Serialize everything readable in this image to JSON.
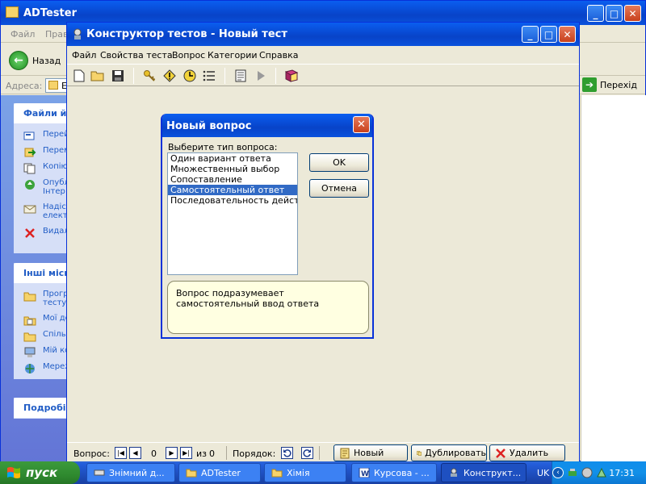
{
  "background_window": {
    "title": "ADTester",
    "menu": [
      "Файл",
      "Прав"
    ],
    "back_label": "Назад",
    "address_label": "Адреса:",
    "address_value": "E",
    "go_label": "Перехід",
    "taskpane_sections": [
      {
        "title": "Файли й п",
        "items": [
          {
            "label": "Перей",
            "icon": "rename-icon"
          },
          {
            "label": "Перем",
            "icon": "move-icon"
          },
          {
            "label": "Копію",
            "icon": "copy-icon"
          },
          {
            "label": "Опублі",
            "sub": "Інтер",
            "icon": "publish-icon"
          },
          {
            "label": "Надіс",
            "sub": "елект",
            "icon": "email-icon"
          },
          {
            "label": "Видал",
            "icon": "delete-icon"
          }
        ]
      },
      {
        "title": "Інші місц",
        "items": [
          {
            "label": "Прогр",
            "sub": "тесту",
            "icon": "folder-icon"
          },
          {
            "label": "Мої до",
            "icon": "documents-icon"
          },
          {
            "label": "Спіль",
            "icon": "folder-icon"
          },
          {
            "label": "Мій ко",
            "icon": "computer-icon"
          },
          {
            "label": "Мереж",
            "icon": "network-icon"
          }
        ]
      },
      {
        "title": "Подробі",
        "items": []
      }
    ]
  },
  "main_window": {
    "title": "Конструктор тестов - Новый тест",
    "menu": [
      "Файл",
      "Свойства теста",
      "Вопрос",
      "Категории",
      "Справка"
    ],
    "toolbar_icons": [
      "new-file-icon",
      "open-folder-icon",
      "save-icon",
      "key-icon",
      "warning-icon",
      "clock-icon",
      "list-icon",
      "properties-icon",
      "play-icon",
      "book-icon"
    ],
    "status": {
      "question_label": "Вопрос:",
      "question_index": "0",
      "of_label": "из",
      "question_total": "0",
      "order_label": "Порядок:",
      "new_button": "Новый",
      "duplicate_button": "Дублировать",
      "delete_button": "Удалить"
    }
  },
  "dialog": {
    "title": "Новый вопрос",
    "prompt": "Выберите тип вопроса:",
    "question_types": [
      "Один вариант ответа",
      "Множественный выбор",
      "Сопоставление",
      "Самостоятельный ответ",
      "Последовательность действий"
    ],
    "selected_index": 3,
    "ok_button": "OK",
    "cancel_button": "Отмена",
    "description": "Вопрос подразумевает самостоятельный ввод ответа"
  },
  "taskbar": {
    "start_label": "пуск",
    "tasks": [
      {
        "label": "Знімний д...",
        "icon": "drive-icon",
        "active": false
      },
      {
        "label": "ADTester",
        "icon": "folder-icon",
        "active": false
      },
      {
        "label": "Хімія",
        "icon": "folder-icon",
        "active": false
      },
      {
        "label": "Курсова - ...",
        "icon": "word-icon",
        "active": false
      },
      {
        "label": "Конструкт...",
        "icon": "app-icon",
        "active": true
      }
    ],
    "language": "UK",
    "clock": "17:31"
  },
  "colors": {
    "title_bar_blue": "#0a5ef0",
    "selection_blue": "#316ac5",
    "window_bg": "#ece9d8",
    "tooltip_yellow": "#ffffe1",
    "start_green": "#2f8a2f"
  }
}
